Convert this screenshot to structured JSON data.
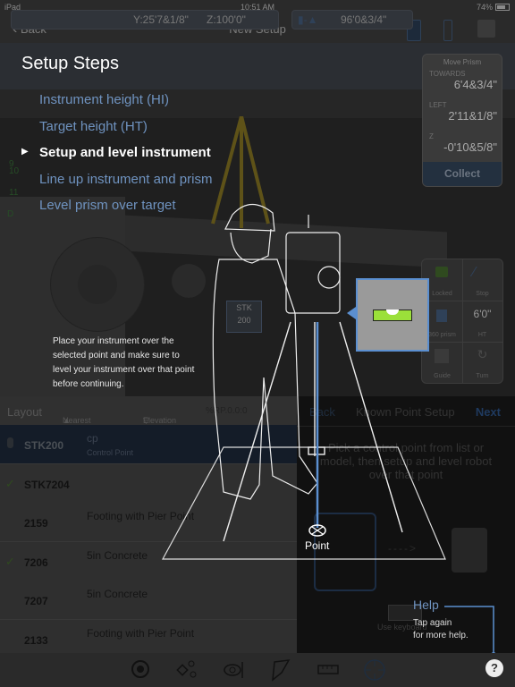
{
  "status_bar": {
    "device": "iPad",
    "time": "10:51 AM",
    "battery": "74%"
  },
  "nav": {
    "back_label": "Back",
    "title": "New Setup"
  },
  "coords": {
    "y": "Y:25'7&1/8\"",
    "z": "Z:100'0\"",
    "distance": "96'0&3/4\""
  },
  "setup_steps": {
    "title": "Setup Steps",
    "steps": [
      {
        "label": "Instrument height (HI)",
        "active": false
      },
      {
        "label": "Target height (HT)",
        "active": false
      },
      {
        "label": "Setup and level instrument",
        "active": true
      },
      {
        "label": "Line up instrument and prism",
        "active": false
      },
      {
        "label": "Level prism over target",
        "active": false
      }
    ],
    "instruction": "Place your instrument over the selected point and make sure to level your instrument over that point before continuing."
  },
  "move_prism": {
    "title": "Move Prism",
    "towards_label": "TOWARDS",
    "towards_value": "6'4&3/4\"",
    "left_label": "LEFT",
    "left_value": "2'11&1/8\"",
    "z_label": "Z",
    "z_value": "-0'10&5/8\"",
    "collect_label": "Collect"
  },
  "controls": {
    "locked": "Locked",
    "stop": "Stop",
    "prism": "360 prism",
    "ht_value": "6'0\"",
    "ht_label": "HT",
    "guide": "Guide",
    "turn": "Turn"
  },
  "view_labels": {
    "stk": "STK",
    "stk_num": "200",
    "grid_nums": [
      "9",
      "10",
      "11",
      "D"
    ]
  },
  "layout_list": {
    "title": "Layout",
    "sort": "Nearest",
    "filter": "Elevation",
    "rp": "%RP.0.0:0",
    "rows": [
      {
        "id": "STK200",
        "desc": "cp",
        "sub": "Control Point",
        "checked": false,
        "selected": true
      },
      {
        "id": "STK7204",
        "desc": "",
        "sub": "",
        "checked": true,
        "selected": false
      },
      {
        "id": "2159",
        "desc": "Footing with Pier Point",
        "sub": "",
        "checked": false,
        "selected": false
      },
      {
        "id": "7206",
        "desc": "5in Concrete",
        "sub": "",
        "checked": true,
        "selected": false
      },
      {
        "id": "7207",
        "desc": "5in Concrete",
        "sub": "",
        "checked": false,
        "selected": false
      },
      {
        "id": "2133",
        "desc": "Footing with Pier Point",
        "sub": "",
        "checked": false,
        "selected": false
      }
    ]
  },
  "known_point": {
    "back": "Back",
    "title": "Known Point Setup",
    "next": "Next",
    "text": "Pick a control point from list or model, then setup and level robot over that point",
    "keyboard": "Use keyboard"
  },
  "overlay": {
    "point_label": "Point",
    "help_title": "Help",
    "help_tip_1": "Tap again",
    "help_tip_2": "for more help.",
    "help_button": "?"
  },
  "colors": {
    "accent": "#6f93c0",
    "bubble": "#9be03a",
    "level_box": "#9a9a9a"
  }
}
